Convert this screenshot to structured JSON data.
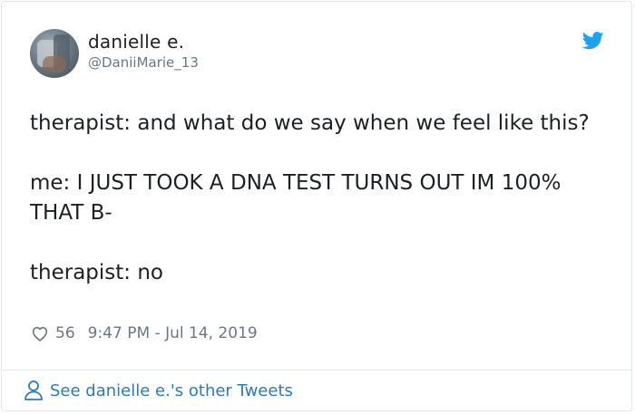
{
  "author": {
    "name": "danielle e.",
    "handle": "@DaniiMarie_13"
  },
  "tweet": {
    "paragraphs": [
      "therapist: and what do we say when we feel like this?",
      "me: I JUST TOOK A DNA TEST TURNS OUT IM 100% THAT B-",
      "therapist: no"
    ],
    "likes": "56",
    "timestamp": "9:47 PM - Jul 14, 2019"
  },
  "footer": {
    "link_label": "See danielle e.'s other Tweets"
  },
  "colors": {
    "brand_blue": "#1da1f2",
    "link_blue": "#2b7bb9",
    "muted_gray": "#697882"
  },
  "icons": [
    "twitter-bird-icon",
    "heart-icon",
    "user-icon"
  ]
}
